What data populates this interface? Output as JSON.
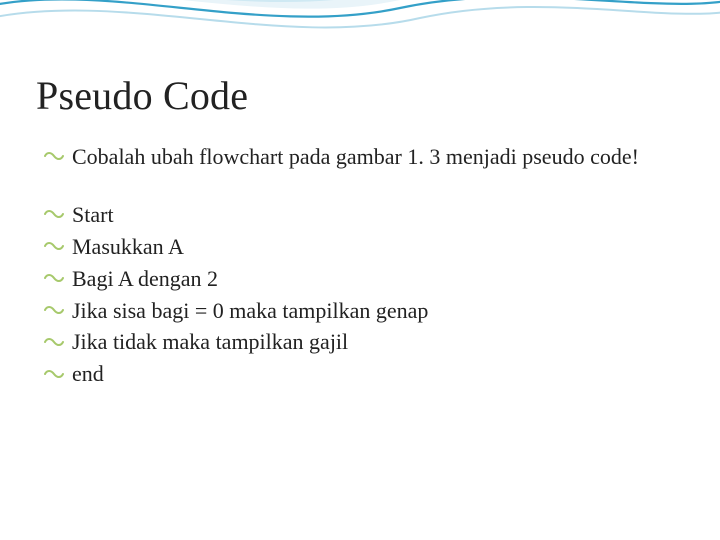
{
  "title": "Pseudo Code",
  "intro": "Cobalah ubah flowchart pada gambar 1. 3 menjadi pseudo code!",
  "steps": [
    "Start",
    "Masukkan A",
    "Bagi A dengan 2",
    "Jika sisa bagi = 0 maka tampilkan genap",
    "Jika tidak maka tampilkan gajil",
    "end"
  ],
  "colors": {
    "accent": "#34a0c8",
    "bullet": "#a7c96c"
  }
}
